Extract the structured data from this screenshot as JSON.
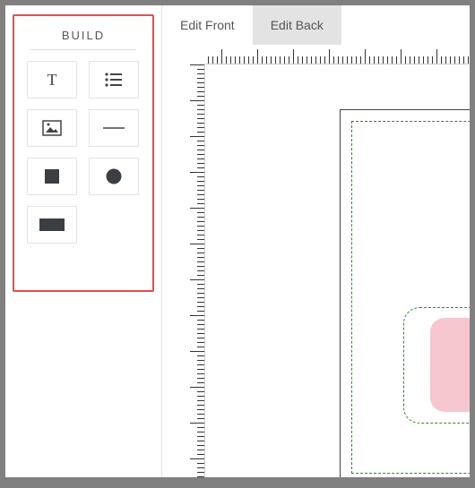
{
  "sidebar": {
    "title": "BUILD",
    "tools": [
      {
        "name": "text-tool",
        "icon": "text-icon"
      },
      {
        "name": "list-tool",
        "icon": "bullet-list-icon"
      },
      {
        "name": "image-tool",
        "icon": "image-icon"
      },
      {
        "name": "line-tool",
        "icon": "horizontal-line-icon"
      },
      {
        "name": "square-tool",
        "icon": "square-icon"
      },
      {
        "name": "circle-tool",
        "icon": "circle-icon"
      },
      {
        "name": "rectangle-tool",
        "icon": "rectangle-icon"
      }
    ]
  },
  "tabs": {
    "front": "Edit Front",
    "back": "Edit Back",
    "active": "front"
  }
}
